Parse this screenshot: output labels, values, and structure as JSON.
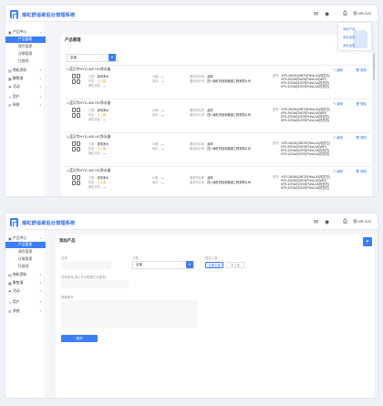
{
  "app": {
    "title": "南虹舒适家后台管理系统",
    "user": "MR.GUO"
  },
  "screen1": {
    "nav": [
      {
        "label": "产品中心",
        "icon": "box-icon",
        "arrow": "▴"
      },
      {
        "label": "产品管理",
        "active": true
      },
      {
        "label": "属性管理"
      },
      {
        "label": "详情管理"
      },
      {
        "label": "拉曲线"
      },
      {
        "label": "商机资料",
        "icon": "document-icon",
        "arrow": "▾"
      },
      {
        "label": "聚焦墙",
        "icon": "grid-icon",
        "arrow": "▾"
      },
      {
        "label": "活动",
        "icon": "flag-icon",
        "arrow": "▾"
      },
      {
        "label": "用户",
        "icon": "user-icon",
        "arrow": "▾"
      },
      {
        "label": "系统",
        "icon": "gear-icon",
        "arrow": "▾"
      }
    ],
    "page_title": "产品管理",
    "filter_value": "全部",
    "dropdown": [
      "添加产品",
      "添加品类",
      "添加品类"
    ],
    "card": {
      "name": "1.蓝贝华HYD-400 HO净水器",
      "type_label": "分类：",
      "type_value": "家用净水",
      "status_label": "状态：",
      "status_value": "已上架",
      "sales_label": "销售状态：",
      "sales_value": "—",
      "price_label": "价格：",
      "price_value": "—",
      "stock_label": "库存：",
      "stock_value": "—",
      "provider_label": "服务商名称：",
      "provider_value": "孟明",
      "company_label": "服务商公司：",
      "company_value": "四川南虹舒适家暖通工程有限公司",
      "model_label": "型号：",
      "models": [
        "KFR-26GW/(26575)FNhA-A3(咬苏白)",
        "KFR-26GW/(26575)FNhA-A3(WIFI)",
        "KFR-32GW/(32575)FNhA-A3(咬苏白)",
        "KFR-32GW/(32575)FNhA-A3(咬苏白)"
      ],
      "edit": "编辑",
      "delete": "删除"
    },
    "card_count": 4
  },
  "screen2": {
    "nav": [
      {
        "label": "产品中心",
        "icon": "box-icon",
        "arrow": "▴"
      },
      {
        "label": "产品管理",
        "active": true
      },
      {
        "label": "属性管理"
      },
      {
        "label": "详情管理"
      },
      {
        "label": "拉曲线"
      },
      {
        "label": "商机资料",
        "icon": "document-icon",
        "arrow": "▾"
      },
      {
        "label": "聚焦墙",
        "icon": "grid-icon",
        "arrow": "▾"
      },
      {
        "label": "活动",
        "icon": "flag-icon",
        "arrow": "▾"
      },
      {
        "label": "用户",
        "icon": "user-icon",
        "arrow": "▾"
      },
      {
        "label": "系统",
        "icon": "gear-icon",
        "arrow": "▾"
      }
    ],
    "page_title": "添加产品",
    "fields": {
      "name_label": "名称",
      "category_label": "分类",
      "category_value": "全部",
      "status_label": "是否上架",
      "status_yes": "立即上架",
      "status_no": "不上架",
      "model_label": "关联型号(请以开头配置左包配型)",
      "desc_label": "规格型号"
    },
    "save": "保存"
  },
  "colors": {
    "accent": "#3d7ef7",
    "warn": "#e6a23c"
  }
}
